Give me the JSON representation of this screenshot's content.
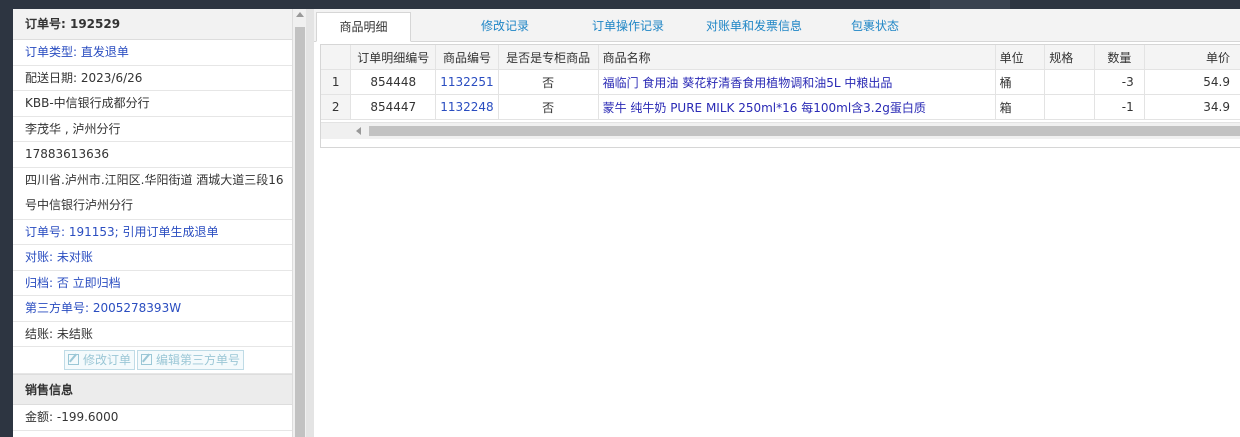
{
  "order_panel": {
    "header": "订单号: 192529",
    "order_type": "订单类型: 直发退单",
    "delivery_date": "配送日期: 2023/6/26",
    "customer": "KBB-中信银行成都分行",
    "contact": "李茂华 , 泸州分行",
    "phone": "17883613636",
    "address": "四川省.泸州市.江阳区.华阳街道 酒城大道三段16号中信银行泸州分行",
    "source_order": "订单号: 191153; 引用订单生成退单",
    "reconcile": "对账: 未对账",
    "archive": "归档:  否 立即归档",
    "third_party": "第三方单号: 2005278393W",
    "settlement": "结账: 未结账",
    "edit_order_btn": "修改订单",
    "edit_third_btn": "编辑第三方单号",
    "sales_header": "销售信息",
    "amount": "金额: -199.6000"
  },
  "tabs": [
    "商品明细",
    "修改记录",
    "订单操作记录",
    "对账单和发票信息",
    "包裹状态"
  ],
  "table": {
    "headers": [
      "",
      "订单明细编号",
      "商品编号",
      "是否是专柜商品",
      "商品名称",
      "单位",
      "规格",
      "数量",
      "单价"
    ],
    "rows": [
      [
        "1",
        "854448",
        "1132251",
        "否",
        "福临门 食用油 葵花籽清香食用植物调和油5L 中粮出品",
        "桶",
        "",
        "-3",
        "54.9"
      ],
      [
        "2",
        "854447",
        "1132248",
        "否",
        "蒙牛 纯牛奶 PURE MILK 250ml*16 每100ml含3.2g蛋白质",
        "箱",
        "",
        "-1",
        "34.9"
      ]
    ]
  },
  "colors": {
    "link": "#2a4dc0",
    "tab": "#1f86c6",
    "chrome": "#2d3541"
  },
  "icons": [
    "edit-icon",
    "scroll-up-arrow-icon",
    "scroll-left-arrow-icon"
  ]
}
